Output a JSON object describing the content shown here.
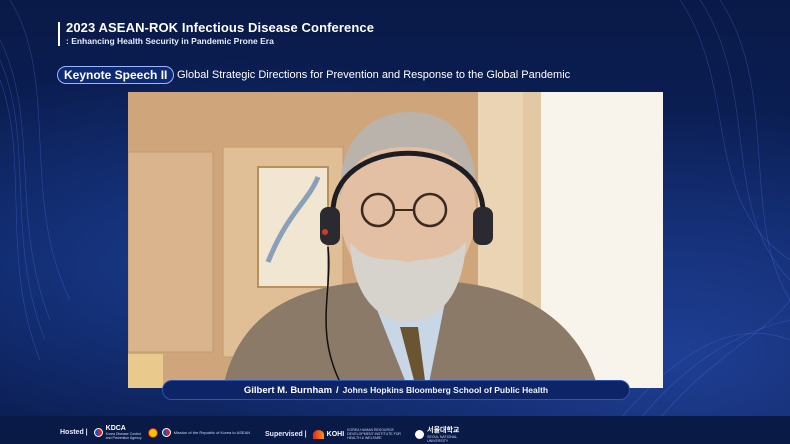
{
  "header": {
    "title": "2023 ASEAN-ROK Infectious Disease Conference",
    "subtitle": ": Enhancing Health Security in Pandemic Prone Era"
  },
  "keynote": {
    "badge": "Keynote Speech II",
    "title": "Global Strategic Directions for Prevention and Response to the Global Pandemic"
  },
  "speaker": {
    "name": "Gilbert M. Burnham",
    "separator": "/",
    "affiliation": "Johns Hopkins Bloomberg School of Public Health"
  },
  "footer": {
    "hosted_label": "Hosted |",
    "kdca": "KDCA",
    "kdca_sub": "Korea Disease Control and Prevention Agency",
    "mission": "Mission of the Republic of Korea to ASEAN",
    "supervised_label": "Supervised |",
    "kohi": "KOHI",
    "kohi_sub": "KOREA HUMAN RESOURCE DEVELOPMENT INSTITUTE FOR HEALTH & WELFARE",
    "snu": "서울대학교",
    "snu_sub": "SEOUL NATIONAL UNIVERSITY"
  },
  "colors": {
    "background": "#0b1d4f",
    "accent": "#2d52b8",
    "caption_bg": "#0d2466"
  }
}
